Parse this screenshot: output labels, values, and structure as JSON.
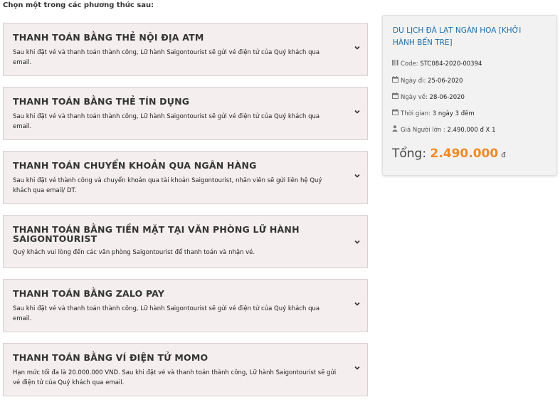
{
  "intro": "Chọn một trong các phương thức sau:",
  "methods": [
    {
      "title": "THANH TOÁN BẰNG THẺ NỘI ĐỊA ATM",
      "desc": "Sau khi đặt vé và thanh toán thành công, Lữ hành Saigontourist sẽ gửi vé điện tử của Quý khách qua email."
    },
    {
      "title": "THANH TOÁN BẰNG THẺ TÍN DỤNG",
      "desc": "Sau khi đặt vé và thanh toán thành công, Lữ hành Saigontourist sẽ gửi vé điện tử của Quý khách qua email."
    },
    {
      "title": "THANH TOÁN CHUYỂN KHOẢN QUA NGÂN HÀNG",
      "desc": "Sau khi đặt vé thành công và chuyển khoản qua tài khoản Saigontourist, nhân viên sẽ gửi liên hệ Quý khách qua email/ DT."
    },
    {
      "title": "THANH TOÁN BẰNG TIỀN MẶT TẠI VĂN PHÒNG LỮ HÀNH SAIGONTOURIST",
      "desc": "Quý khách vui lòng đến các văn phòng Saigontourist để thanh toán và nhận vé."
    },
    {
      "title": "THANH TOÁN BẰNG ZALO PAY",
      "desc": "Sau khi đặt vé và thanh toán thành công, Lữ hành Saigontourist sẽ gửi vé điện tử của Quý khách qua email."
    },
    {
      "title": "THANH TOÁN BẰNG VÍ ĐIỆN TỬ MOMO",
      "desc": "Hạn mức tối đa là 20.000.000 VND. Sau khi đặt vé và thanh toán thành công, Lữ hành Saigontourist sẽ gửi vé điện tử của Quý khách qua email."
    }
  ],
  "summary": {
    "tour_name": "DU LỊCH ĐÀ LẠT NGÀN HOA [KHỞI HÀNH BẾN TRE]",
    "code_label": "Code:",
    "code_value": "STC084-2020-00394",
    "depart_label": "Ngày đi:",
    "depart_value": "25-06-2020",
    "return_label": "Ngày về:",
    "return_value": "28-06-2020",
    "duration_label": "Thời gian:",
    "duration_value": "3 ngày 3 đêm",
    "adult_price_label": "Giá Người lớn :",
    "adult_price_value": "2.490.000",
    "adult_price_unit": "đ X 1",
    "total_label": "Tổng:",
    "total_value": "2.490.000",
    "total_currency": "đ"
  }
}
